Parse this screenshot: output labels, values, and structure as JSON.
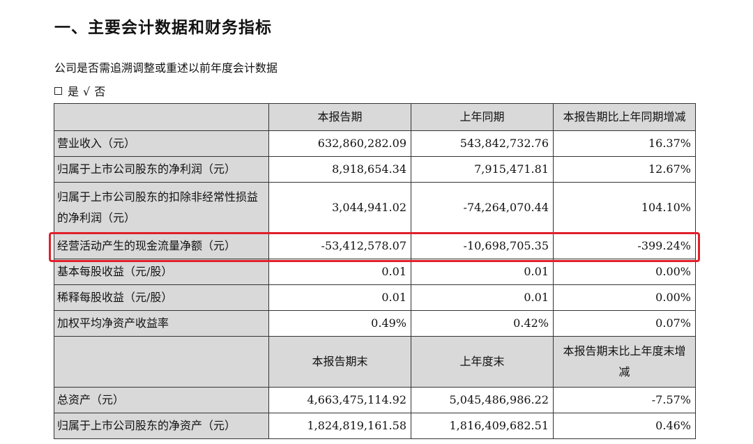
{
  "heading": "一、主要会计数据和财务指标",
  "question": "公司是否需追溯调整或重述以前年度会计数据",
  "options": {
    "yes_label": "是",
    "check_mark": "√",
    "no_label": "否"
  },
  "table1": {
    "headers": [
      "本报告期",
      "上年同期",
      "本报告期比上年同期增减"
    ],
    "rows": [
      {
        "label": "营业收入（元）",
        "current": "632,860,282.09",
        "prior": "543,842,732.76",
        "change": "16.37%"
      },
      {
        "label": "归属于上市公司股东的净利润（元）",
        "current": "8,918,654.34",
        "prior": "7,915,471.81",
        "change": "12.67%"
      },
      {
        "label": "归属于上市公司股东的扣除非经常性损益的净利润（元）",
        "current": "3,044,941.02",
        "prior": "-74,264,070.44",
        "change": "104.10%"
      },
      {
        "label": "经营活动产生的现金流量净额（元）",
        "current": "-53,412,578.07",
        "prior": "-10,698,705.35",
        "change": "-399.24%"
      },
      {
        "label": "基本每股收益（元/股）",
        "current": "0.01",
        "prior": "0.01",
        "change": "0.00%"
      },
      {
        "label": "稀释每股收益（元/股）",
        "current": "0.01",
        "prior": "0.01",
        "change": "0.00%"
      },
      {
        "label": "加权平均净资产收益率",
        "current": "0.49%",
        "prior": "0.42%",
        "change": "0.07%"
      }
    ]
  },
  "table2": {
    "headers": [
      "本报告期末",
      "上年度末",
      "本报告期末比上年度末增减"
    ],
    "rows": [
      {
        "label": "总资产（元）",
        "current": "4,663,475,114.92",
        "prior": "5,045,486,986.22",
        "change": "-7.57%"
      },
      {
        "label": "归属于上市公司股东的净资产（元）",
        "current": "1,824,819,161.58",
        "prior": "1,816,409,682.51",
        "change": "0.46%"
      }
    ]
  },
  "colors": {
    "highlight_border": "#e0202a",
    "header_fill": "#d9d9d9"
  }
}
